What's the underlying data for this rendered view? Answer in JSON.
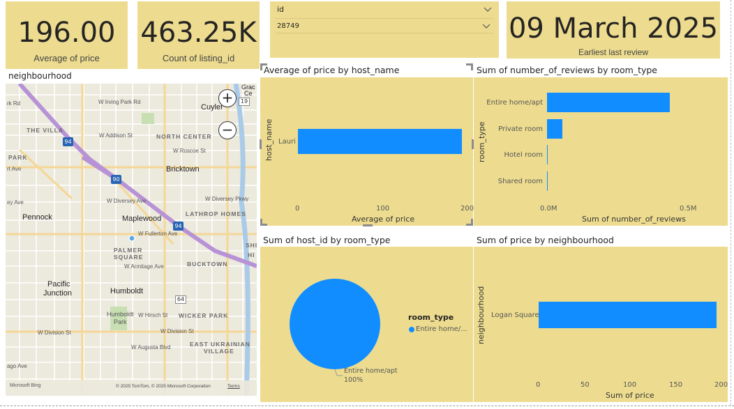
{
  "kpis": {
    "avg_price": {
      "value": "196.00",
      "label": "Average of price"
    },
    "count_listing": {
      "value": "463.25K",
      "label": "Count of listing_id"
    },
    "earliest_review": {
      "value": "09 March 2025",
      "label": "Earliest last  review"
    }
  },
  "slicer": {
    "field": "id",
    "selected": "28749"
  },
  "map": {
    "title": "neighbourhood",
    "zoom_in": "+",
    "zoom_out": "−",
    "credit": "© 2025 TomTom, © 2025 Microsoft Corporation",
    "terms": "Terms",
    "brand": "Microsoft Bing",
    "places": {
      "cuyler": "Cuyler",
      "bricktown": "Bricktown",
      "pennock": "Pennock",
      "maplewood": "Maplewood",
      "humboldt": "Humboldt",
      "pacific": "Pacific",
      "junction": "Junction",
      "humboldt_park1": "Humboldt",
      "humboldt_park2": "Park",
      "grace": "Grac",
      "ce": "Ce"
    },
    "areas": {
      "the_villa": "THE VILLA",
      "north_center": "NORTH CENTER",
      "park": "PARK",
      "lathrop": "LATHROP HOMES",
      "palmer1": "PALMER",
      "palmer2": "SQUARE",
      "bucktown": "BUCKTOWN",
      "wicker": "WICKER PARK",
      "ukrainian1": "EAST UKRAINIAN",
      "ukrainian2": "VILLAGE",
      "shi": "SHI",
      "hi": "HI"
    },
    "streets": {
      "irving": "W Irving Park Rd",
      "addison": "W Addison St",
      "roscoe": "W Roscoe St",
      "diversey1": "W Diversey Ave",
      "diversey2": "W Diversey Pkwy",
      "fullerton": "W Fullerton Ave",
      "armitage": "W Armitage Ave",
      "hirsch": "W Hirsch St",
      "division1": "W Division St",
      "division2": "W Division St",
      "augusta": "W Augusta Blvd",
      "rk": "rk Rd",
      "ave1": "rt Ave",
      "ave2": "ey Ave",
      "ave3": "ago Ave",
      "milwaukee": "N Milwaukee Ave",
      "elston1": "N Elston Ave",
      "elston2": "N Elston Ave",
      "kimball1": "N Kimball Ave",
      "kimball2": "N Kimball Ave",
      "western1": "N Western Av",
      "western2": "N Western Ave",
      "pulaski": "N Pulaski Rd",
      "kedzie": "N Kedzie Ave",
      "california": "N California Ave",
      "ashland1": "N Ashland Av",
      "ashland2": "N Ashland Av",
      "stone": "ston Ave",
      "kilbourn": "N Kilbourn"
    },
    "shields": {
      "i94a": "94",
      "i94b": "94",
      "i90": "90",
      "r19": "19",
      "r64": "64"
    }
  },
  "colors": {
    "card": "#eddc8f",
    "bar": "#118dff",
    "pie": "#118dff"
  },
  "chart_data": [
    {
      "type": "bar",
      "orientation": "horizontal",
      "title": "Average of price by host_name",
      "xlabel": "Average of price",
      "ylabel": "host_name",
      "categories": [
        "Lauri"
      ],
      "values": [
        196
      ],
      "xlim": [
        0,
        200
      ],
      "xticks": [
        "0",
        "100",
        "200"
      ]
    },
    {
      "type": "bar",
      "orientation": "horizontal",
      "title": "Sum of number_of_reviews by room_type",
      "xlabel": "Sum of number_of_reviews",
      "ylabel": "room_type",
      "categories": [
        "Entire home/apt",
        "Private room",
        "Hotel room",
        "Shared room"
      ],
      "values": [
        440000,
        55000,
        3000,
        2000
      ],
      "xlim": [
        0,
        600000
      ],
      "xticks": [
        "0.0M",
        "0.5M"
      ]
    },
    {
      "type": "pie",
      "title": "Sum of host_id by room_type",
      "legend_title": "room_type",
      "legend_entry": "Entire home/...",
      "categories": [
        "Entire home/apt"
      ],
      "values": [
        100
      ],
      "data_label_1": "Entire home/apt",
      "data_label_2": "100%"
    },
    {
      "type": "bar",
      "orientation": "horizontal",
      "title": "Sum of price by neighbourhood",
      "xlabel": "Sum of price",
      "ylabel": "neighbourhood",
      "categories": [
        "Logan Square"
      ],
      "values": [
        196
      ],
      "xlim": [
        0,
        200
      ],
      "xticks": [
        "0",
        "50",
        "100",
        "150",
        "200"
      ]
    }
  ]
}
